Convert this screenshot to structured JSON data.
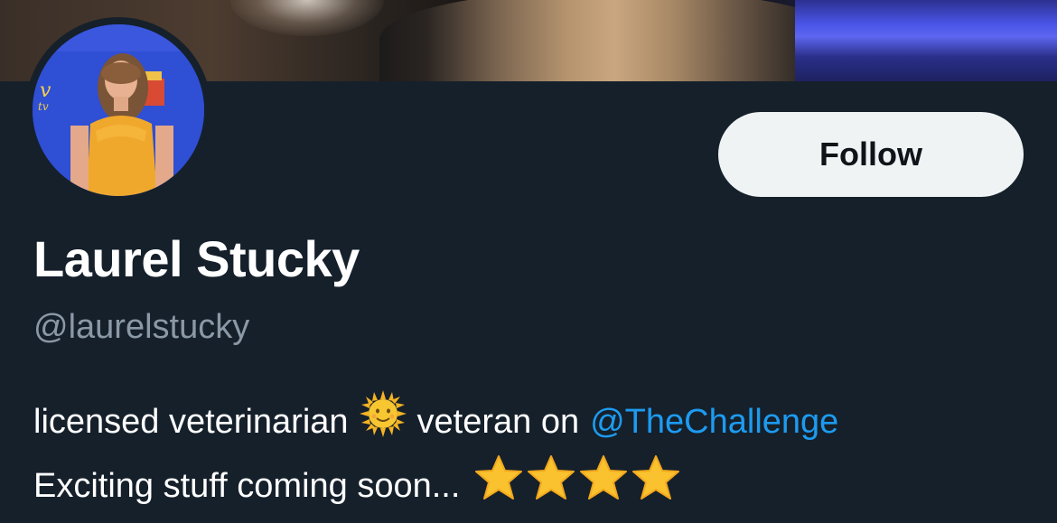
{
  "profile": {
    "display_name": "Laurel Stucky",
    "handle": "@laurelstucky",
    "follow_label": "Follow",
    "bio": {
      "line1_text_a": "licensed veterinarian",
      "line1_emoji": "sun-with-face-emoji",
      "line1_text_b": "veteran on",
      "line1_mention": "@TheChallenge",
      "line2_text": "Exciting stuff coming soon...",
      "line2_emojis": [
        "star-emoji",
        "star-emoji",
        "star-emoji",
        "star-emoji"
      ]
    }
  },
  "colors": {
    "background": "#15202b",
    "name": "#ffffff",
    "handle": "#8b98a5",
    "mention": "#1d9bf0",
    "follow_bg": "#eff3f4",
    "follow_text": "#0f1419"
  },
  "icons": {
    "banner": "profile-banner-image",
    "avatar": "profile-avatar-image"
  }
}
